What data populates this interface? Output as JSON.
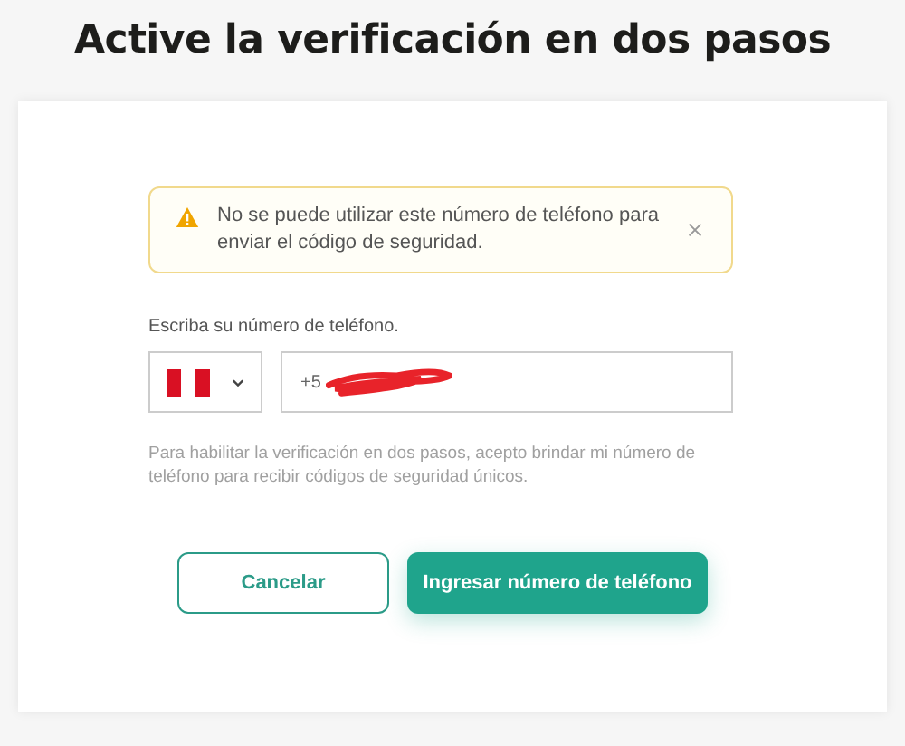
{
  "title": "Active la verificación en dos pasos",
  "alert": {
    "message": "No se puede utilizar este número de teléfono para enviar el código de seguridad."
  },
  "phone": {
    "label": "Escriba su número de teléfono.",
    "value": "+5",
    "redacted": true
  },
  "consent": "Para habilitar la verificación en dos pasos, acepto brindar mi número de teléfono para recibir códigos de seguridad únicos.",
  "buttons": [
    {
      "label": "Cancelar",
      "kind": "secondary"
    },
    {
      "label": "Ingresar número de teléfono",
      "kind": "primary"
    }
  ]
}
